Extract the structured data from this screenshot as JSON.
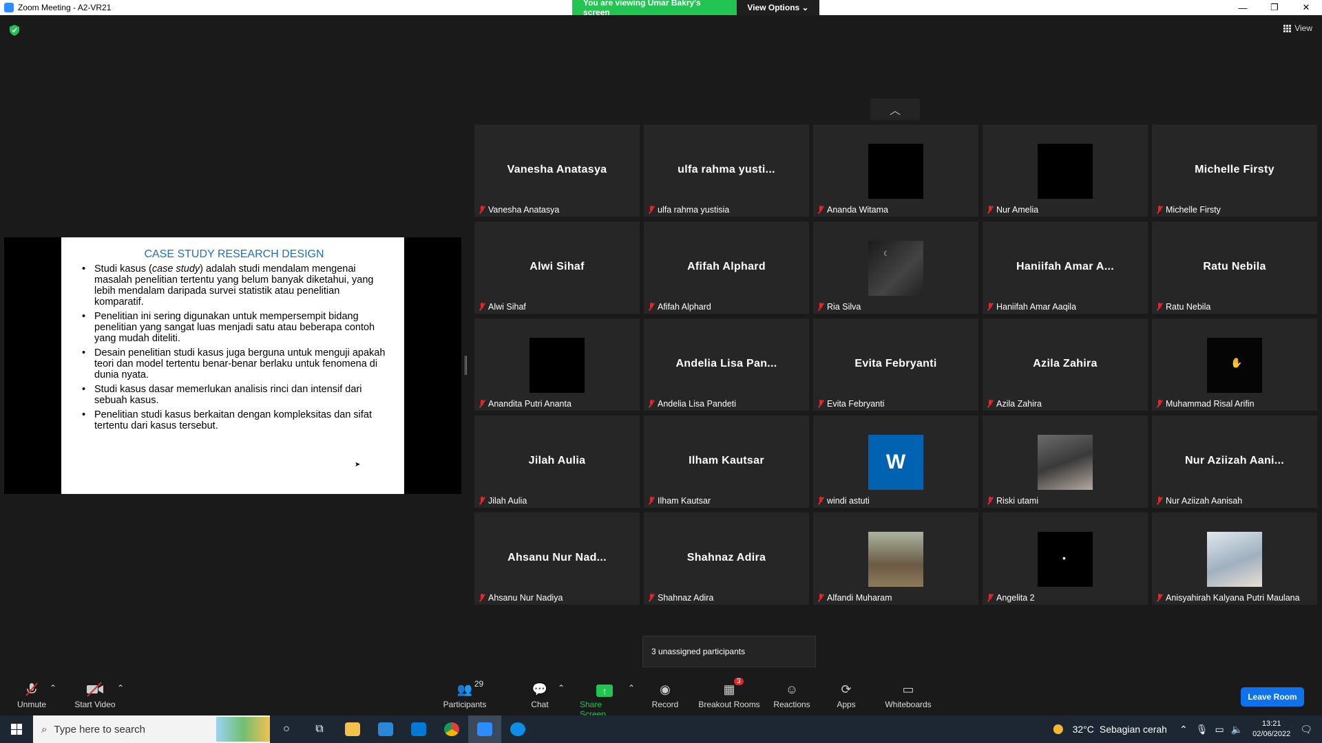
{
  "window": {
    "title": "Zoom Meeting - A2-VR21",
    "viewing_message": "You are viewing Umar Bakry's screen",
    "view_options": "View Options ⌄",
    "view_label": "View"
  },
  "slide": {
    "title": "CASE STUDY RESEARCH DESIGN",
    "bullets": [
      {
        "before": "Studi kasus (",
        "italic": "case study",
        "after": ") adalah studi mendalam mengenai masalah penelitian tertentu yang belum banyak diketahui, yang lebih mendalam daripada survei statistik atau penelitian komparatif."
      },
      {
        "text": "Penelitian ini sering digunakan untuk mempersempit bidang penelitian yang sangat luas menjadi satu atau beberapa contoh yang mudah diteliti."
      },
      {
        "text": "Desain penelitian studi kasus juga berguna untuk menguji apakah teori dan model tertentu benar-benar berlaku untuk fenomena di dunia nyata."
      },
      {
        "text": "Studi kasus dasar memerlukan analisis rinci dan intensif dari sebuah kasus."
      },
      {
        "text": "Penelitian studi kasus berkaitan dengan kompleksitas dan sifat tertentu dari kasus tersebut."
      }
    ]
  },
  "participants": [
    {
      "center": "Vanesha Anatasya",
      "name": "Vanesha Anatasya",
      "thumb": ""
    },
    {
      "center": "ulfa rahma yusti...",
      "name": "ulfa rahma yustisia",
      "thumb": ""
    },
    {
      "center": "",
      "name": "Ananda Witama",
      "thumb": "black"
    },
    {
      "center": "",
      "name": "Nur Amelia",
      "thumb": "black"
    },
    {
      "center": "Michelle Firsty",
      "name": "Michelle Firsty",
      "thumb": ""
    },
    {
      "center": "Alwi Sihaf",
      "name": "Alwi Sihaf",
      "thumb": ""
    },
    {
      "center": "Afifah Alphard",
      "name": "Afifah Alphard",
      "thumb": ""
    },
    {
      "center": "",
      "name": "Ria Silva",
      "thumb": "photo-night"
    },
    {
      "center": "Haniifah Amar A...",
      "name": "Haniifah Amar Aaqila",
      "thumb": ""
    },
    {
      "center": "Ratu Nebila",
      "name": "Ratu Nebila",
      "thumb": ""
    },
    {
      "center": "",
      "name": "Anandita Putri Ananta",
      "thumb": "black"
    },
    {
      "center": "Andelia Lisa Pan...",
      "name": "Andelia Lisa Pandeti",
      "thumb": ""
    },
    {
      "center": "Evita Febryanti",
      "name": "Evita Febryanti",
      "thumb": ""
    },
    {
      "center": "Azila Zahira",
      "name": "Azila Zahira",
      "thumb": ""
    },
    {
      "center": "",
      "name": "Muhammad Risal Arifin",
      "thumb": "photo-hand"
    },
    {
      "center": "Jilah Aulia",
      "name": "Jilah Aulia",
      "thumb": ""
    },
    {
      "center": "Ilham Kautsar",
      "name": "Ilham Kautsar",
      "thumb": ""
    },
    {
      "center": "",
      "name": "windi astuti",
      "thumb": "word",
      "thumb_letter": "W"
    },
    {
      "center": "",
      "name": "Riski utami",
      "thumb": "photo-room"
    },
    {
      "center": "Nur Aziizah Aani...",
      "name": "Nur Aziizah Aanisah",
      "thumb": ""
    },
    {
      "center": "Ahsanu Nur Nad...",
      "name": "Ahsanu Nur Nadiya",
      "thumb": ""
    },
    {
      "center": "Shahnaz Adira",
      "name": "Shahnaz Adira",
      "thumb": ""
    },
    {
      "center": "",
      "name": "Alfandi Muharam",
      "thumb": "photo-man"
    },
    {
      "center": "",
      "name": "Angelita 2",
      "thumb": "photo-dot"
    },
    {
      "center": "",
      "name": "Anisyahirah Kalyana Putri Maulana",
      "thumb": "photo-stairs"
    }
  ],
  "unassigned_text": "3 unassigned participants",
  "toolbar": {
    "unmute": "Unmute",
    "start_video": "Start Video",
    "participants": "Participants",
    "participants_count": "29",
    "chat": "Chat",
    "share_screen": "Share Screen",
    "record": "Record",
    "breakout_rooms": "Breakout Rooms",
    "breakout_badge": "3",
    "reactions": "Reactions",
    "apps": "Apps",
    "whiteboards": "Whiteboards",
    "leave_room": "Leave Room"
  },
  "taskbar": {
    "search_placeholder": "Type here to search",
    "temperature": "32°C",
    "weather": "Sebagian cerah",
    "time": "13:21",
    "date": "02/06/2022"
  },
  "colors": {
    "zoom_blue": "#0e72ed",
    "banner_green": "#23c552",
    "muted_red": "#e02828",
    "slide_title_blue": "#1f6fb5"
  }
}
